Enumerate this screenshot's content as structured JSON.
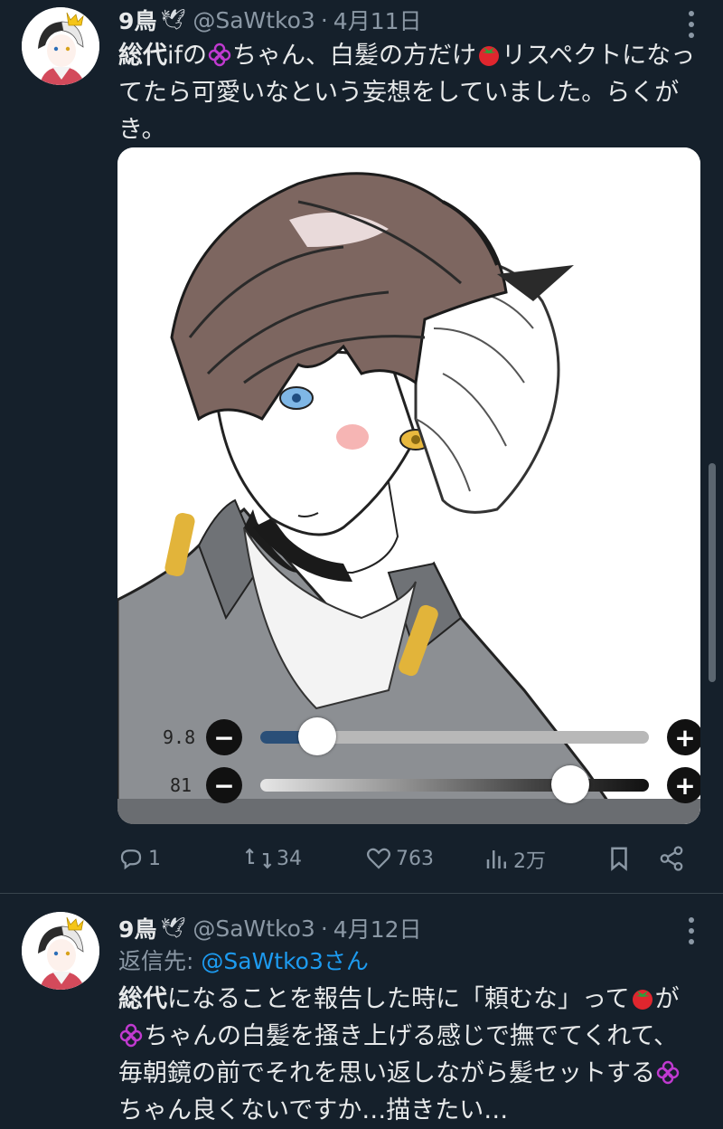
{
  "tweets": [
    {
      "author": "9鳥",
      "handle": "@SaWtko3",
      "separator": "·",
      "date": "4月11日",
      "text_parts": [
        "総代",
        "ifの",
        "ちゃん、白髪の方だけ",
        "リスペクトになってたら可愛いなという妄想をしていました。らくがき。"
      ],
      "media": {
        "sliders": [
          {
            "label": "9.8",
            "value": 0.15
          },
          {
            "label": "81",
            "value": 0.81
          }
        ]
      },
      "actions": {
        "replies": "1",
        "retweets": "34",
        "likes": "763",
        "views": "2万"
      }
    },
    {
      "author": "9鳥",
      "handle": "@SaWtko3",
      "separator": "·",
      "date": "4月12日",
      "reply_prefix": "返信先: ",
      "reply_target": "@SaWtko3さん",
      "text_parts": [
        "総代",
        "になることを報告した時に「頼むな」って",
        "が",
        "ちゃんの白髪を掻き上げる感じで撫でてくれて、毎朝鏡の前でそれを思い返しながら髪セットする",
        "ちゃん良くないですか…描きたい…"
      ]
    }
  ],
  "icons": [
    "dove-icon",
    "clover-emoji",
    "tomato-emoji",
    "reply-icon",
    "retweet-icon",
    "like-icon",
    "views-icon",
    "bookmark-icon",
    "share-icon",
    "more-icon"
  ],
  "colors": {
    "background": "#15202b",
    "text": "#e7e9ea",
    "muted": "#8b98a5",
    "link": "#1d9bf0"
  }
}
